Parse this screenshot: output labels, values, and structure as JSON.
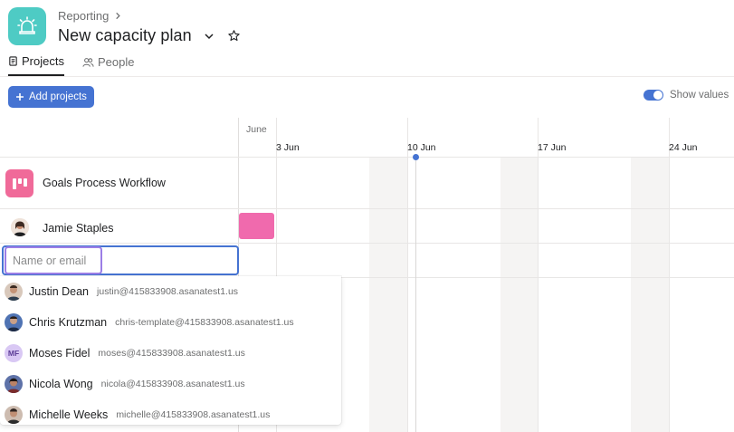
{
  "breadcrumb": {
    "parent": "Reporting"
  },
  "header": {
    "title": "New capacity plan"
  },
  "tabs": [
    {
      "label": "Projects",
      "active": true
    },
    {
      "label": "People",
      "active": false
    }
  ],
  "toolbar": {
    "add_projects_label": "Add projects",
    "show_values_label": "Show values",
    "show_values_on": true
  },
  "timeline": {
    "month": "June",
    "weeks": [
      "3 Jun",
      "10 Jun",
      "17 Jun",
      "24 Jun"
    ]
  },
  "project": {
    "name": "Goals Process Workflow",
    "color": "#f06a99"
  },
  "member": {
    "name": "Jamie Staples",
    "allocation_color": "#f06aad"
  },
  "search": {
    "placeholder": "Name or email",
    "value": ""
  },
  "suggestions": [
    {
      "name": "Justin Dean",
      "email": "justin@415833908.asanatest1.us",
      "avatar": "photo",
      "avatar_color": "#c9a58c"
    },
    {
      "name": "Chris Krutzman",
      "email": "chris-template@415833908.asanatest1.us",
      "avatar": "photo",
      "avatar_color": "#5b7fb8"
    },
    {
      "name": "Moses Fidel",
      "email": "moses@415833908.asanatest1.us",
      "avatar": "MF",
      "avatar_color": "#d9c8f4"
    },
    {
      "name": "Nicola Wong",
      "email": "nicola@415833908.asanatest1.us",
      "avatar": "photo",
      "avatar_color": "#6a7fae"
    },
    {
      "name": "Michelle Weeks",
      "email": "michelle@415833908.asanatest1.us",
      "avatar": "photo",
      "avatar_color": "#b89a86"
    }
  ],
  "colors": {
    "accent": "#4573d2",
    "app_icon": "#4ecbc4",
    "input_focus": "#9b7ee6"
  }
}
